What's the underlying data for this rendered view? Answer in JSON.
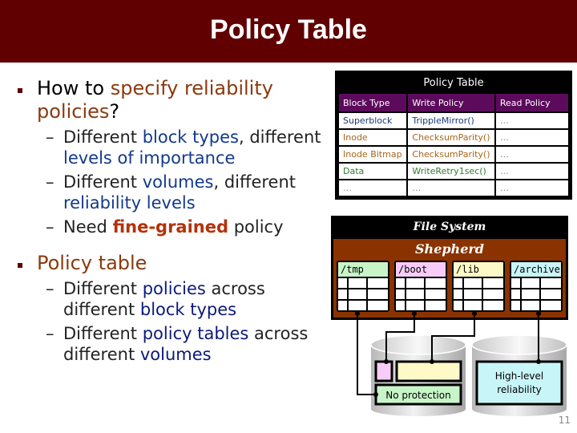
{
  "slide": {
    "title": "Policy Table",
    "page_number": "11"
  },
  "bullets": [
    {
      "level": 1,
      "parts": [
        {
          "text": "How to ",
          "style": "plain"
        },
        {
          "text": "specify reliability policies",
          "style": "brown"
        },
        {
          "text": "?",
          "style": "plain"
        }
      ],
      "children": [
        {
          "parts": [
            {
              "text": "Different ",
              "style": "plain"
            },
            {
              "text": "block types",
              "style": "blue"
            },
            {
              "text": ", different ",
              "style": "plain"
            },
            {
              "text": "levels of importance",
              "style": "blue"
            }
          ]
        },
        {
          "parts": [
            {
              "text": "Different ",
              "style": "plain"
            },
            {
              "text": "volumes",
              "style": "blue"
            },
            {
              "text": ", different ",
              "style": "plain"
            },
            {
              "text": "reliability levels",
              "style": "blue"
            }
          ]
        },
        {
          "parts": [
            {
              "text": "Need ",
              "style": "plain"
            },
            {
              "text": "fine-grained",
              "style": "red-bold"
            },
            {
              "text": " policy",
              "style": "plain"
            }
          ]
        }
      ]
    },
    {
      "level": 1,
      "parts": [
        {
          "text": "Policy table",
          "style": "brown"
        }
      ],
      "children": [
        {
          "parts": [
            {
              "text": "Different ",
              "style": "plain"
            },
            {
              "text": "policies",
              "style": "navy"
            },
            {
              "text": " across different ",
              "style": "plain"
            },
            {
              "text": "block types",
              "style": "navy"
            }
          ]
        },
        {
          "parts": [
            {
              "text": "Different ",
              "style": "plain"
            },
            {
              "text": "policy tables",
              "style": "navy"
            },
            {
              "text": " across different ",
              "style": "plain"
            },
            {
              "text": "volumes",
              "style": "navy"
            }
          ]
        }
      ]
    }
  ],
  "policy_table": {
    "caption": "Policy Table",
    "headers": [
      "Block Type",
      "Write Policy",
      "Read Policy"
    ],
    "rows": [
      {
        "cells": [
          "Superblock",
          "TrippleMirror()",
          "…"
        ],
        "color": "#1a3a7a"
      },
      {
        "cells": [
          "Inode",
          "ChecksumParity()",
          "…"
        ],
        "color": "#a8661a"
      },
      {
        "cells": [
          "Inode Bitmap",
          "ChecksumParity()",
          "…"
        ],
        "color": "#a8661a"
      },
      {
        "cells": [
          "Data",
          "WriteRetry1sec()",
          "…"
        ],
        "color": "#2e7d32"
      },
      {
        "cells": [
          "…",
          "…",
          "…"
        ],
        "color": "#555555"
      }
    ]
  },
  "diagram": {
    "file_system_label": "File System",
    "shepherd_label": "Shepherd",
    "volumes": [
      {
        "name": "/tmp",
        "color": "#c8f5c8"
      },
      {
        "name": "/boot",
        "color": "#f8ccf8"
      },
      {
        "name": "/lib",
        "color": "#fdfac8"
      },
      {
        "name": "/archive",
        "color": "#c8f5f8"
      }
    ],
    "disks": [
      {
        "label": "No protection",
        "color": "#c8f5c8"
      },
      {
        "label": "High-level reliability",
        "color": "#c8f5f8"
      }
    ],
    "colors": {
      "shepherd_bg": "#8b3300",
      "pink_region": "#f8ccf8",
      "yellow_region": "#fdfac8"
    }
  }
}
